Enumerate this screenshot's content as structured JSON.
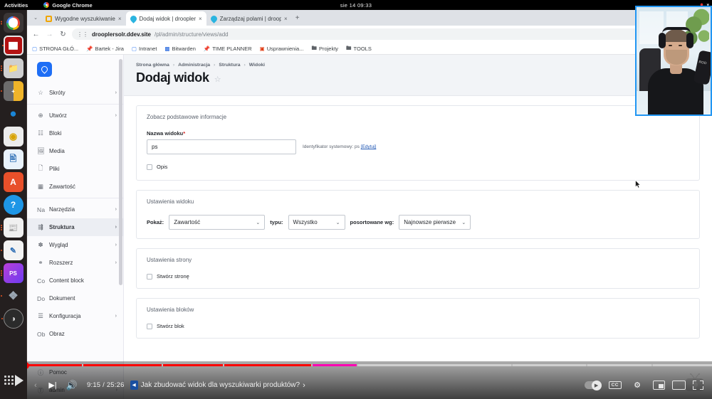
{
  "os": {
    "activities": "Activities",
    "app_name": "Google Chrome",
    "clock": "sie 14  09:33"
  },
  "dock": [
    {
      "name": "chrome",
      "glyph": "",
      "badge": true
    },
    {
      "name": "terminal-red",
      "glyph": "",
      "badge": true
    },
    {
      "name": "files",
      "glyph": "",
      "badge": true
    },
    {
      "name": "calculator",
      "glyph": "",
      "badge": true
    },
    {
      "name": "thunderbird",
      "glyph": "",
      "badge": false
    },
    {
      "name": "audio-app",
      "glyph": "",
      "badge": false
    },
    {
      "name": "libreoffice-writer",
      "glyph": "",
      "badge": false
    },
    {
      "name": "adobe-acrobat",
      "glyph": "A",
      "badge": false
    },
    {
      "name": "help",
      "glyph": "?",
      "badge": false
    },
    {
      "name": "news-reader",
      "glyph": "",
      "badge": true
    },
    {
      "name": "notes-editor",
      "glyph": "",
      "badge": true
    },
    {
      "name": "phpstorm",
      "glyph": "PS",
      "badge": true
    },
    {
      "name": "shutter",
      "glyph": "",
      "badge": true
    },
    {
      "name": "obs-studio",
      "glyph": "",
      "badge": true
    }
  ],
  "browser": {
    "tabs": [
      {
        "title": "Wygodne wyszukiwanie",
        "favicon": "square-yellow",
        "active": false,
        "close": "×"
      },
      {
        "title": "Dodaj widok | droopler",
        "favicon": "droplet",
        "active": true,
        "close": "×"
      },
      {
        "title": "Zarządzaj polami | droop",
        "favicon": "droplet",
        "active": false,
        "close": "×"
      }
    ],
    "new_tab_label": "+",
    "tab_search_label": "⌄",
    "nav": {
      "back": "←",
      "forward": "→",
      "reload": "↻",
      "site_icon": "tune-icon"
    },
    "omnibox": {
      "host": "drooplersolr.ddev.site",
      "path": "/pl/admin/structure/views/add",
      "star": "☆"
    },
    "toolbar_icons": [
      "bookmark-star-icon",
      "extension-orange-icon",
      "extension-person-icon",
      "profile-avatar-icon"
    ],
    "bookmarks": [
      {
        "label": "STRONA GŁÓ...",
        "icon": "page-icon"
      },
      {
        "label": "Bartek - Jira",
        "icon": "pin-icon"
      },
      {
        "label": "Intranet",
        "icon": "page-icon"
      },
      {
        "label": "Bitwarden",
        "icon": "bitwarden-icon"
      },
      {
        "label": "TIME PLANNER",
        "icon": "pin-icon"
      },
      {
        "label": "Usprawnienia...",
        "icon": "doc-icon"
      },
      {
        "label": "Projekty",
        "icon": "folder-icon"
      },
      {
        "label": "TOOLS",
        "icon": "folder-icon"
      }
    ]
  },
  "drupal": {
    "logo_name": "droopler-logo",
    "sidebar_groups": [
      {
        "items": [
          {
            "label": "Skróty",
            "icon": "star-icon",
            "chevron": "›",
            "active": false
          }
        ]
      },
      {
        "items": [
          {
            "label": "Utwórz",
            "icon": "plus-circle-icon",
            "chevron": "›",
            "active": false
          },
          {
            "label": "Bloki",
            "icon": "blocks-icon",
            "chevron": "",
            "active": false
          },
          {
            "label": "Media",
            "icon": "image-icon",
            "chevron": "",
            "active": false
          },
          {
            "label": "Pliki",
            "icon": "file-icon",
            "chevron": "",
            "active": false
          },
          {
            "label": "Zawartość",
            "icon": "content-icon",
            "chevron": "",
            "active": false
          }
        ]
      },
      {
        "items": [
          {
            "label": "Narzędzia",
            "icon": "Na",
            "chevron": "›",
            "active": false
          },
          {
            "label": "Struktura",
            "icon": "structure-icon",
            "chevron": "›",
            "active": true
          },
          {
            "label": "Wygląd",
            "icon": "brush-icon",
            "chevron": "›",
            "active": false
          },
          {
            "label": "Rozszerz",
            "icon": "puzzle-icon",
            "chevron": "›",
            "active": false
          },
          {
            "label": "Content block",
            "icon": "Co",
            "chevron": "",
            "active": false
          },
          {
            "label": "Dokument",
            "icon": "Do",
            "chevron": "",
            "active": false
          },
          {
            "label": "Konfiguracja",
            "icon": "sliders-icon",
            "chevron": "›",
            "active": false
          },
          {
            "label": "Obraz",
            "icon": "Ob",
            "chevron": "",
            "active": false
          }
        ]
      }
    ],
    "sidebar_bottom": [
      {
        "label": "Pomoc",
        "icon": "help-circle-icon",
        "chevron": ""
      },
      {
        "label": "admin",
        "icon": "user-circle-icon",
        "chevron": "›"
      }
    ],
    "breadcrumb": [
      {
        "label": "Strona główna"
      },
      {
        "label": "Administracja"
      },
      {
        "label": "Struktura"
      },
      {
        "label": "Widoki"
      }
    ],
    "breadcrumb_sep": "›",
    "page_title": "Dodaj widok",
    "page_title_star": "☆",
    "cards": [
      {
        "title": "Zobacz podstawowe informacje",
        "field_label": "Nazwa widoku",
        "required_mark": "*",
        "field_value": "ps",
        "machine_prefix": "Identyfikator systemowy: ps",
        "machine_edit": "[Edytuj]",
        "checkbox_label": "Opis"
      },
      {
        "title": "Ustawienia widoku",
        "selects": [
          {
            "label": "Pokaż:",
            "value": "Zawartość",
            "caret": "⌄"
          },
          {
            "label": "typu:",
            "value": "Wszystko",
            "caret": "⌄"
          },
          {
            "label": "posortowane wg:",
            "value": "Najnowsze pierwsze",
            "caret": "⌄"
          }
        ]
      },
      {
        "title": "Ustawienia strony",
        "checkbox_label": "Stwórz stronę"
      },
      {
        "title": "Ustawienia bloków",
        "checkbox_label": "Stwórz blok"
      }
    ],
    "watermark_name": "droopler-tv-watermark"
  },
  "youtube": {
    "time_current": "9:15",
    "time_separator": "/",
    "time_total": "25:26",
    "chapter_icon": "◂",
    "video_title": "Jak zbudować widok dla wyszukiwarki produktów?",
    "next_chevron": "›",
    "play_label": "▶",
    "prev_label": "‹",
    "next_label": "▶|",
    "volume_label": "🔊",
    "autoplay_label": "autoplay-toggle",
    "captions_label": "CC",
    "settings_label": "gear-icon",
    "miniplayer_label": "miniplayer-icon",
    "theater_label": "theater-icon",
    "fullscreen_label": "fullscreen-icon",
    "progress_percent": 36.5,
    "accent_color": "#ff0000",
    "chapter_highlight_color": "#ff00b3",
    "chapters": [
      {
        "width": 3.1,
        "fill": 100,
        "highlight": false
      },
      {
        "width": 8.2,
        "fill": 100,
        "highlight": false
      },
      {
        "width": 11.0,
        "fill": 100,
        "highlight": false
      },
      {
        "width": 8.5,
        "fill": 100,
        "highlight": false
      },
      {
        "width": 12.2,
        "fill": 100,
        "highlight": false
      },
      {
        "width": 6.2,
        "fill": 100,
        "highlight": true
      },
      {
        "width": 21.5,
        "fill": 0,
        "highlight": false
      },
      {
        "width": 10.4,
        "fill": 0,
        "highlight": false
      },
      {
        "width": 9.0,
        "fill": 0,
        "highlight": false
      },
      {
        "width": 8.3,
        "fill": 0,
        "highlight": false
      }
    ]
  }
}
